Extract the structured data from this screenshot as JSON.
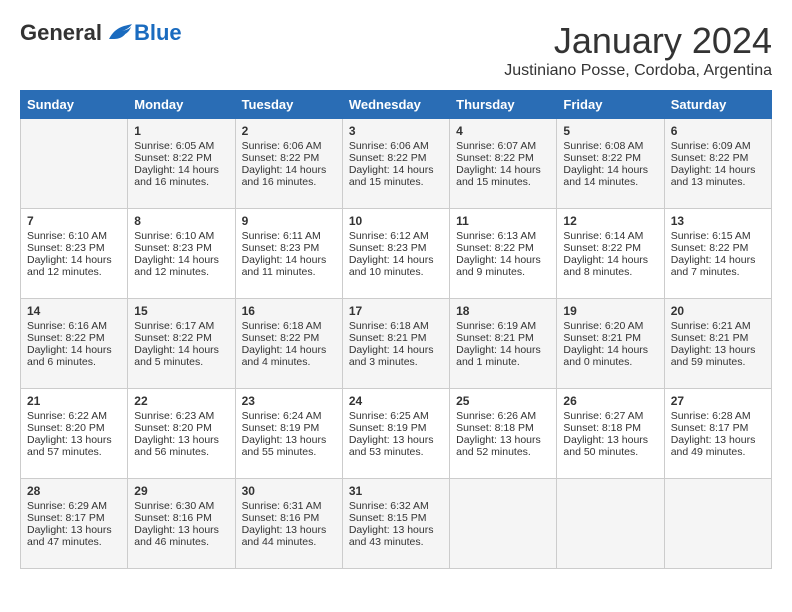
{
  "logo": {
    "general": "General",
    "blue": "Blue"
  },
  "title": "January 2024",
  "subtitle": "Justiniano Posse, Cordoba, Argentina",
  "days_of_week": [
    "Sunday",
    "Monday",
    "Tuesday",
    "Wednesday",
    "Thursday",
    "Friday",
    "Saturday"
  ],
  "weeks": [
    [
      {
        "day": "",
        "content": ""
      },
      {
        "day": "1",
        "content": "Sunrise: 6:05 AM\nSunset: 8:22 PM\nDaylight: 14 hours\nand 16 minutes."
      },
      {
        "day": "2",
        "content": "Sunrise: 6:06 AM\nSunset: 8:22 PM\nDaylight: 14 hours\nand 16 minutes."
      },
      {
        "day": "3",
        "content": "Sunrise: 6:06 AM\nSunset: 8:22 PM\nDaylight: 14 hours\nand 15 minutes."
      },
      {
        "day": "4",
        "content": "Sunrise: 6:07 AM\nSunset: 8:22 PM\nDaylight: 14 hours\nand 15 minutes."
      },
      {
        "day": "5",
        "content": "Sunrise: 6:08 AM\nSunset: 8:22 PM\nDaylight: 14 hours\nand 14 minutes."
      },
      {
        "day": "6",
        "content": "Sunrise: 6:09 AM\nSunset: 8:22 PM\nDaylight: 14 hours\nand 13 minutes."
      }
    ],
    [
      {
        "day": "7",
        "content": "Sunrise: 6:10 AM\nSunset: 8:23 PM\nDaylight: 14 hours\nand 12 minutes."
      },
      {
        "day": "8",
        "content": "Sunrise: 6:10 AM\nSunset: 8:23 PM\nDaylight: 14 hours\nand 12 minutes."
      },
      {
        "day": "9",
        "content": "Sunrise: 6:11 AM\nSunset: 8:23 PM\nDaylight: 14 hours\nand 11 minutes."
      },
      {
        "day": "10",
        "content": "Sunrise: 6:12 AM\nSunset: 8:23 PM\nDaylight: 14 hours\nand 10 minutes."
      },
      {
        "day": "11",
        "content": "Sunrise: 6:13 AM\nSunset: 8:22 PM\nDaylight: 14 hours\nand 9 minutes."
      },
      {
        "day": "12",
        "content": "Sunrise: 6:14 AM\nSunset: 8:22 PM\nDaylight: 14 hours\nand 8 minutes."
      },
      {
        "day": "13",
        "content": "Sunrise: 6:15 AM\nSunset: 8:22 PM\nDaylight: 14 hours\nand 7 minutes."
      }
    ],
    [
      {
        "day": "14",
        "content": "Sunrise: 6:16 AM\nSunset: 8:22 PM\nDaylight: 14 hours\nand 6 minutes."
      },
      {
        "day": "15",
        "content": "Sunrise: 6:17 AM\nSunset: 8:22 PM\nDaylight: 14 hours\nand 5 minutes."
      },
      {
        "day": "16",
        "content": "Sunrise: 6:18 AM\nSunset: 8:22 PM\nDaylight: 14 hours\nand 4 minutes."
      },
      {
        "day": "17",
        "content": "Sunrise: 6:18 AM\nSunset: 8:21 PM\nDaylight: 14 hours\nand 3 minutes."
      },
      {
        "day": "18",
        "content": "Sunrise: 6:19 AM\nSunset: 8:21 PM\nDaylight: 14 hours\nand 1 minute."
      },
      {
        "day": "19",
        "content": "Sunrise: 6:20 AM\nSunset: 8:21 PM\nDaylight: 14 hours\nand 0 minutes."
      },
      {
        "day": "20",
        "content": "Sunrise: 6:21 AM\nSunset: 8:21 PM\nDaylight: 13 hours\nand 59 minutes."
      }
    ],
    [
      {
        "day": "21",
        "content": "Sunrise: 6:22 AM\nSunset: 8:20 PM\nDaylight: 13 hours\nand 57 minutes."
      },
      {
        "day": "22",
        "content": "Sunrise: 6:23 AM\nSunset: 8:20 PM\nDaylight: 13 hours\nand 56 minutes."
      },
      {
        "day": "23",
        "content": "Sunrise: 6:24 AM\nSunset: 8:19 PM\nDaylight: 13 hours\nand 55 minutes."
      },
      {
        "day": "24",
        "content": "Sunrise: 6:25 AM\nSunset: 8:19 PM\nDaylight: 13 hours\nand 53 minutes."
      },
      {
        "day": "25",
        "content": "Sunrise: 6:26 AM\nSunset: 8:18 PM\nDaylight: 13 hours\nand 52 minutes."
      },
      {
        "day": "26",
        "content": "Sunrise: 6:27 AM\nSunset: 8:18 PM\nDaylight: 13 hours\nand 50 minutes."
      },
      {
        "day": "27",
        "content": "Sunrise: 6:28 AM\nSunset: 8:17 PM\nDaylight: 13 hours\nand 49 minutes."
      }
    ],
    [
      {
        "day": "28",
        "content": "Sunrise: 6:29 AM\nSunset: 8:17 PM\nDaylight: 13 hours\nand 47 minutes."
      },
      {
        "day": "29",
        "content": "Sunrise: 6:30 AM\nSunset: 8:16 PM\nDaylight: 13 hours\nand 46 minutes."
      },
      {
        "day": "30",
        "content": "Sunrise: 6:31 AM\nSunset: 8:16 PM\nDaylight: 13 hours\nand 44 minutes."
      },
      {
        "day": "31",
        "content": "Sunrise: 6:32 AM\nSunset: 8:15 PM\nDaylight: 13 hours\nand 43 minutes."
      },
      {
        "day": "",
        "content": ""
      },
      {
        "day": "",
        "content": ""
      },
      {
        "day": "",
        "content": ""
      }
    ]
  ]
}
